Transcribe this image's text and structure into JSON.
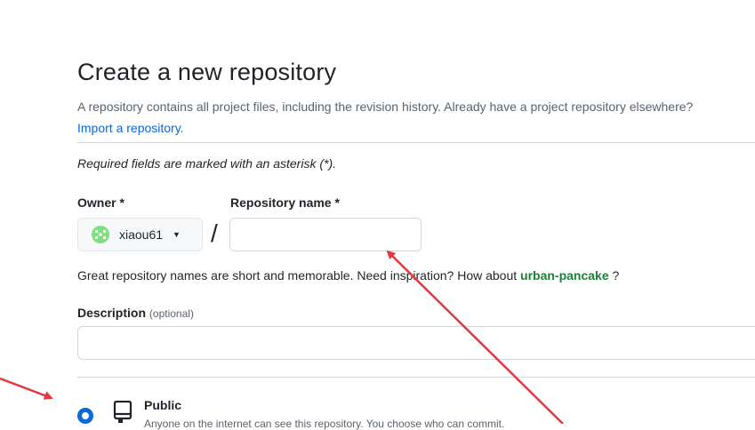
{
  "page": {
    "title": "Create a new repository",
    "intro_text": "A repository contains all project files, including the revision history. Already have a project repository elsewhere?",
    "import_link": "Import a repository.",
    "required_note": "Required fields are marked with an asterisk (*)."
  },
  "owner": {
    "label": "Owner *",
    "selected": "xiaou61",
    "avatar_icon": "identicon-avatar",
    "caret_icon": "caret-down-icon"
  },
  "separator": "/",
  "repository": {
    "label": "Repository name *",
    "value": "",
    "hint_prefix": "Great repository names are short and memorable. Need inspiration? How about",
    "suggestion": "urban-pancake",
    "hint_suffix": "?"
  },
  "description": {
    "label": "Description",
    "optional_label": "(optional)",
    "value": ""
  },
  "visibility": {
    "option_label": "Public",
    "option_desc": "Anyone on the internet can see this repository. You choose who can commit.",
    "selected": true,
    "icon": "repo-icon"
  },
  "colors": {
    "link": "#0969da",
    "suggestion": "#1a7f37",
    "annotation_arrow": "#e0393e",
    "radio": "#0969da",
    "avatar": "#7ee07e"
  }
}
